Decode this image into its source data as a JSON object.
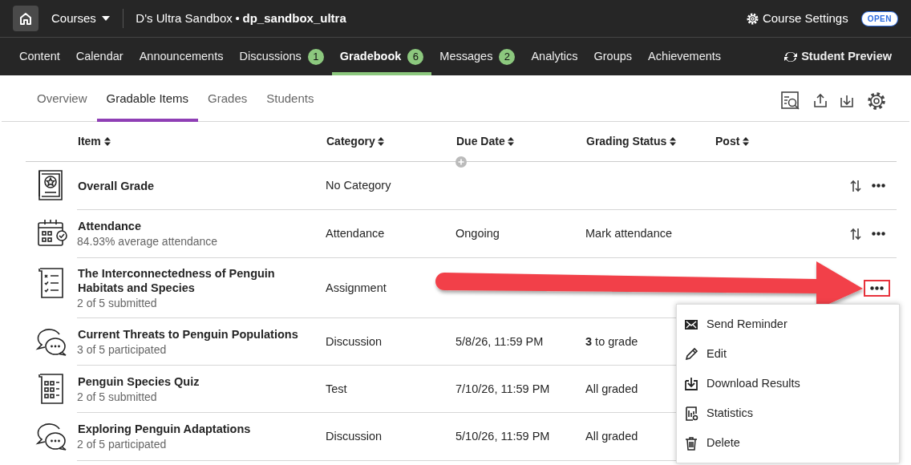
{
  "top_bar": {
    "courses": "Courses",
    "course_name": "D's Ultra Sandbox",
    "separator": "•",
    "course_id": "dp_sandbox_ultra",
    "settings": "Course Settings",
    "status_badge": "OPEN"
  },
  "main_nav": {
    "items": [
      {
        "label": "Content",
        "selected": false
      },
      {
        "label": "Calendar",
        "selected": false
      },
      {
        "label": "Announcements",
        "selected": false
      },
      {
        "label": "Discussions",
        "count": "1",
        "selected": false
      },
      {
        "label": "Gradebook",
        "count": "6",
        "selected": true
      },
      {
        "label": "Messages",
        "count": "2",
        "selected": false
      },
      {
        "label": "Analytics",
        "selected": false
      },
      {
        "label": "Groups",
        "selected": false
      },
      {
        "label": "Achievements",
        "selected": false
      }
    ],
    "student_preview": "Student Preview"
  },
  "sub_tabs": [
    {
      "label": "Overview",
      "selected": false
    },
    {
      "label": "Gradable Items",
      "selected": true
    },
    {
      "label": "Grades",
      "selected": false
    },
    {
      "label": "Students",
      "selected": false
    }
  ],
  "table": {
    "columns": [
      "Item",
      "Category",
      "Due Date",
      "Grading Status",
      "Post"
    ],
    "rows": [
      {
        "kind": "overall",
        "title": "Overall Grade",
        "category": "No Category",
        "show_reorder": true,
        "show_more": true
      },
      {
        "kind": "attendance",
        "title": "Attendance",
        "subtitle": "84.93% average attendance",
        "category": "Attendance",
        "due": "Ongoing",
        "status": "Mark attendance",
        "show_reorder": true,
        "show_more": true
      },
      {
        "kind": "assignment",
        "title": "The Interconnectedness of Penguin Habitats and Species",
        "subtitle": "2 of 5 submitted",
        "category": "Assignment",
        "show_more": true,
        "highlighted": true
      },
      {
        "kind": "discussion",
        "title": "Current Threats to Penguin Populations",
        "subtitle": "3 of 5 participated",
        "category": "Discussion",
        "due": "5/8/26, 11:59 PM",
        "status": "**3** to grade"
      },
      {
        "kind": "test",
        "title": "Penguin Species Quiz",
        "subtitle": "2 of 5 submitted",
        "category": "Test",
        "due": "7/10/26, 11:59 PM",
        "status": "All graded"
      },
      {
        "kind": "discussion",
        "title": "Exploring Penguin Adaptations",
        "subtitle": "2 of 5 participated",
        "category": "Discussion",
        "due": "5/10/26, 11:59 PM",
        "status": "All graded"
      }
    ]
  },
  "menu": {
    "items": [
      {
        "kind": "reminder",
        "label": "Send Reminder"
      },
      {
        "kind": "edit",
        "label": "Edit"
      },
      {
        "kind": "download",
        "label": "Download Results"
      },
      {
        "kind": "statistics",
        "label": "Statistics"
      },
      {
        "kind": "delete",
        "label": "Delete"
      }
    ]
  }
}
